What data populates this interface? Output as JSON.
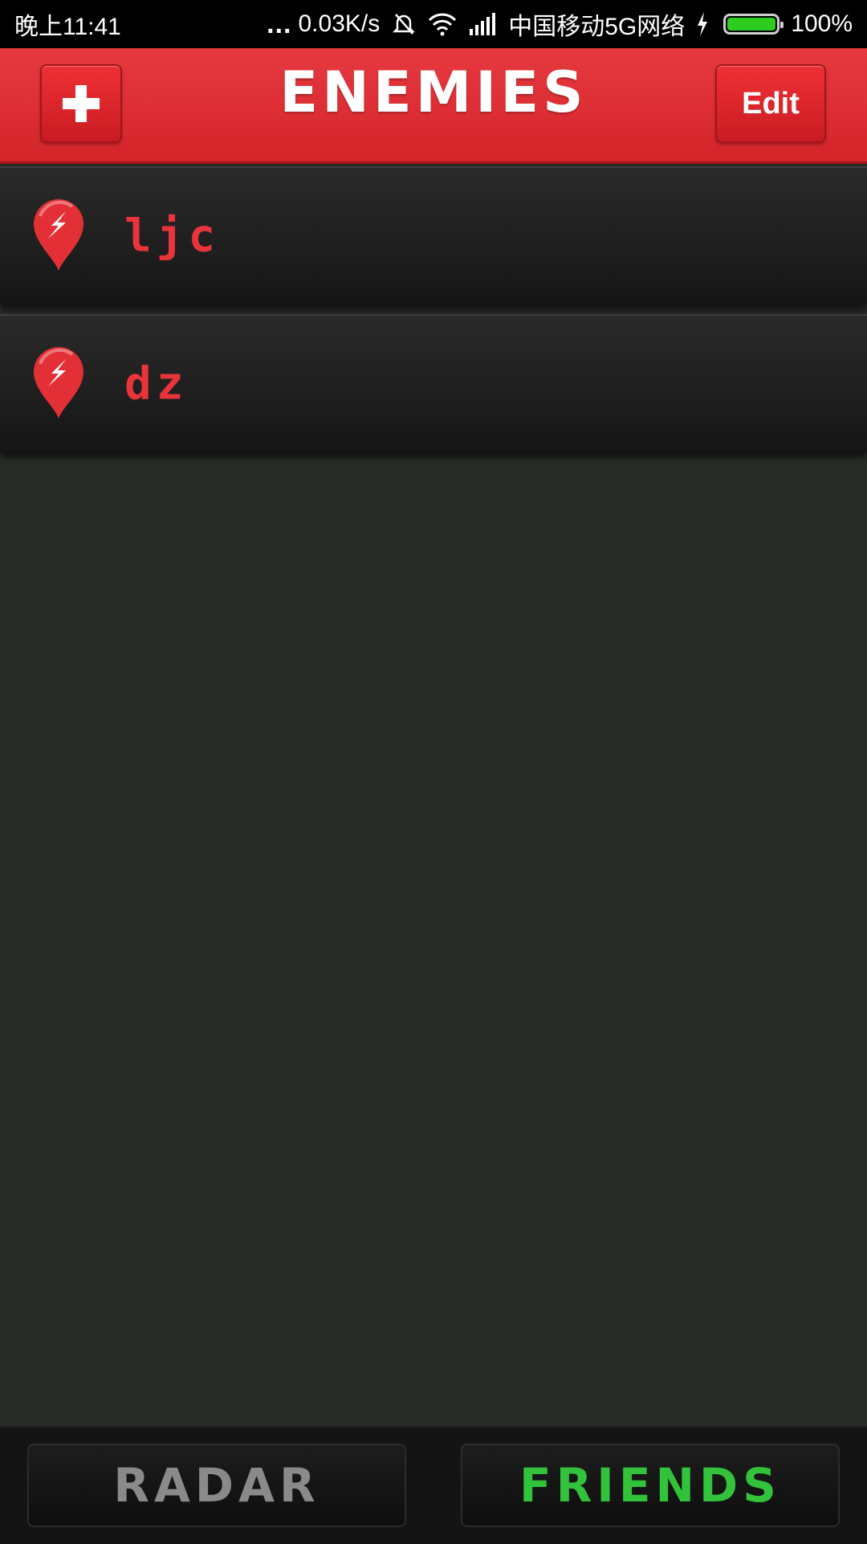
{
  "status_bar": {
    "time": "晚上11:41",
    "dots": "...",
    "speed": "0.03K/s",
    "carrier": "中国移动5G网络",
    "battery": "100%",
    "icons": [
      "mute-bell-icon",
      "wifi-icon",
      "signal-icon",
      "charging-icon",
      "battery-icon"
    ]
  },
  "header": {
    "add_icon": "plus-icon",
    "title": "ENEMIES",
    "edit_label": "Edit"
  },
  "list": {
    "items": [
      {
        "label": "ljc",
        "icon": "pin-icon"
      },
      {
        "label": "dz",
        "icon": "pin-icon"
      }
    ]
  },
  "bottom_tabs": {
    "radar_label": "RADAR",
    "friends_label": "FRIENDS"
  },
  "colors": {
    "accent_red": "#e33036",
    "friends_green": "#33c23b",
    "background": "#282b28"
  }
}
